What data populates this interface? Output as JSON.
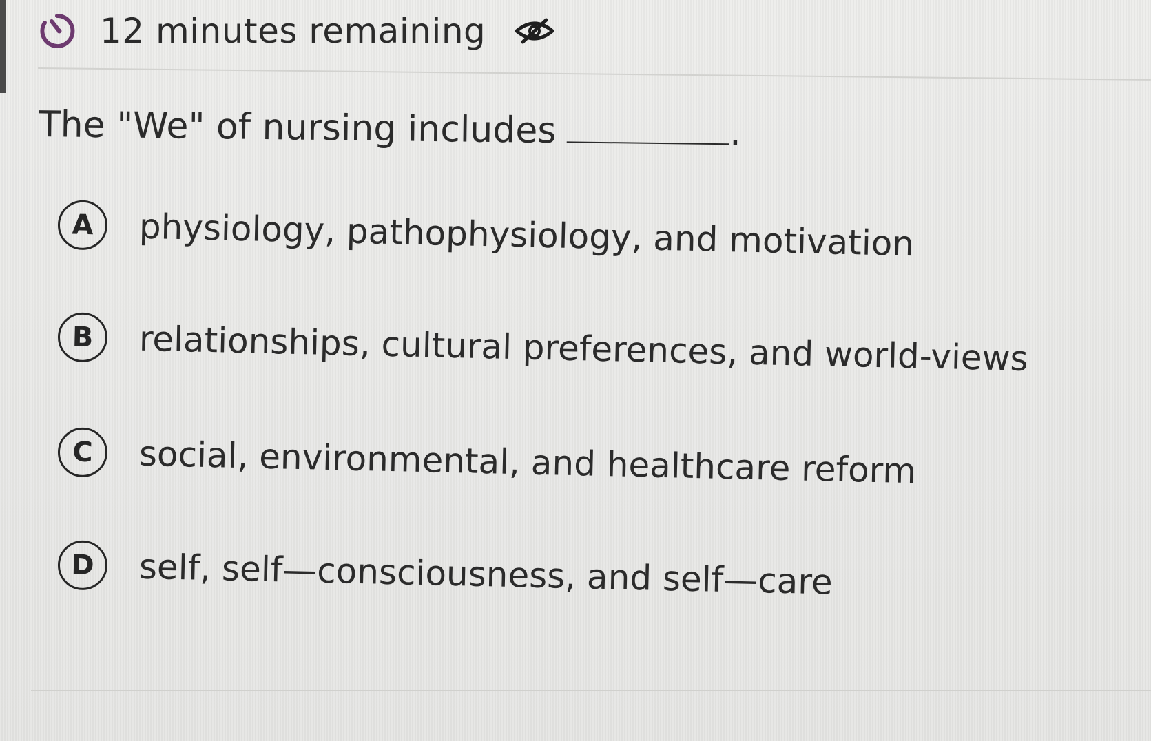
{
  "timer": {
    "remaining": "12 minutes remaining",
    "icon": "timer-icon",
    "toggle_icon": "hide-eye-icon"
  },
  "question": {
    "text": "The \"We\" of nursing includes",
    "trailing": "."
  },
  "options": [
    {
      "letter": "A",
      "text": "physiology, pathophysiology, and motivation"
    },
    {
      "letter": "B",
      "text": "relationships, cultural preferences, and world-views"
    },
    {
      "letter": "C",
      "text": "social, environmental, and healthcare reform"
    },
    {
      "letter": "D",
      "text": "self, self—consciousness, and self—care"
    }
  ],
  "colors": {
    "background": "#e9e9e7",
    "text": "#2b2b2b",
    "badge_border": "#262626",
    "timer_accent": "#6d3a6f"
  }
}
